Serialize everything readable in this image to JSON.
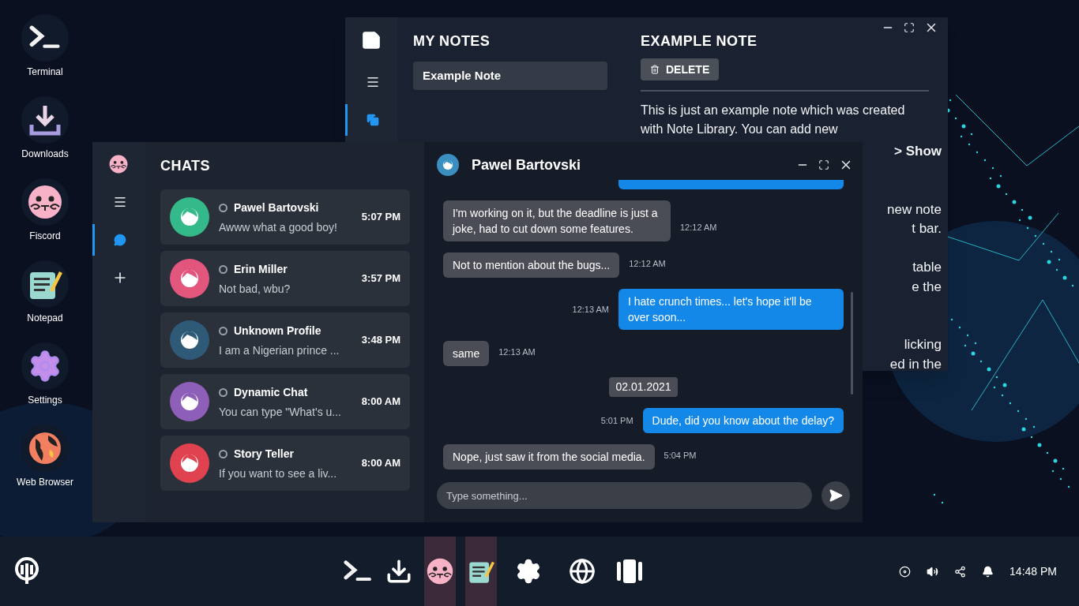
{
  "desktop_icons": [
    {
      "kind": "terminal",
      "label": "Terminal"
    },
    {
      "kind": "downloads",
      "label": "Downloads"
    },
    {
      "kind": "fiscord",
      "label": "Fiscord"
    },
    {
      "kind": "notepad",
      "label": "Notepad"
    },
    {
      "kind": "settings",
      "label": "Settings"
    },
    {
      "kind": "browser",
      "label": "Web Browser"
    }
  ],
  "notes_window": {
    "sidebar": [
      {
        "kind": "menu",
        "selected": false
      },
      {
        "kind": "notes",
        "selected": true
      }
    ],
    "list_title": "MY NOTES",
    "notes": [
      {
        "title": "Example Note",
        "selected": true
      }
    ],
    "note": {
      "title": "EXAMPLE NOTE",
      "delete_label": "DELETE",
      "visible_text": "This is just an example note which was created with Note Library. You can add new",
      "uncovered_fragments": [
        "**> Show**",
        "new note",
        "t bar.",
        "table",
        "e the",
        "licking",
        "ed in the"
      ]
    }
  },
  "chat_window": {
    "sidebar": [
      {
        "kind": "menu",
        "selected": false
      },
      {
        "kind": "chats",
        "selected": true
      },
      {
        "kind": "add",
        "selected": false
      }
    ],
    "title": "CHATS",
    "chats": [
      {
        "name": "Pawel Bartovski",
        "preview": "Awww what a good boy!",
        "time": "5:07 PM",
        "color": "#34b98a"
      },
      {
        "name": "Erin Miller",
        "preview": "Not bad, wbu?",
        "time": "3:57 PM",
        "color": "#e2567e"
      },
      {
        "name": "Unknown Profile",
        "preview": "I am a Nigerian prince ...",
        "time": "3:48 PM",
        "color": "#2e5a78"
      },
      {
        "name": "Dynamic Chat",
        "preview": "You can type \"What's u...",
        "time": "8:00 AM",
        "color": "#8e5fb8"
      },
      {
        "name": "Story Teller",
        "preview": "If you want to see a liv...",
        "time": "8:00 AM",
        "color": "#e0434f"
      }
    ],
    "conversation": {
      "contact": "Pawel Bartovski",
      "messages": [
        {
          "kind": "outgoing-cut"
        },
        {
          "kind": "incoming",
          "text": "I'm working on it, but the deadline is just a joke, had to cut down some features.",
          "time": "12:12 AM"
        },
        {
          "kind": "incoming",
          "text": "Not to mention about the bugs...",
          "time": "12:12 AM"
        },
        {
          "kind": "outgoing",
          "text": "I hate crunch times... let's hope it'll be over soon...",
          "time": "12:13 AM"
        },
        {
          "kind": "incoming",
          "text": "same",
          "time": "12:13 AM"
        },
        {
          "kind": "date",
          "text": "02.01.2021"
        },
        {
          "kind": "outgoing",
          "text": "Dude, did you know about the delay?",
          "time": "5:01 PM"
        },
        {
          "kind": "incoming",
          "text": "Nope, just saw it from the social media.",
          "time": "5:04 PM"
        }
      ],
      "input": {
        "placeholder": "Type something..."
      }
    }
  },
  "taskbar": {
    "apps": [
      {
        "kind": "terminal",
        "running": false
      },
      {
        "kind": "downloads",
        "running": false
      },
      {
        "kind": "fiscord",
        "running": true
      },
      {
        "kind": "notepad",
        "running": true
      },
      {
        "kind": "settings",
        "running": false
      },
      {
        "kind": "browser",
        "running": false
      },
      {
        "kind": "widgets",
        "running": false
      }
    ],
    "clock": "14:48 PM"
  }
}
